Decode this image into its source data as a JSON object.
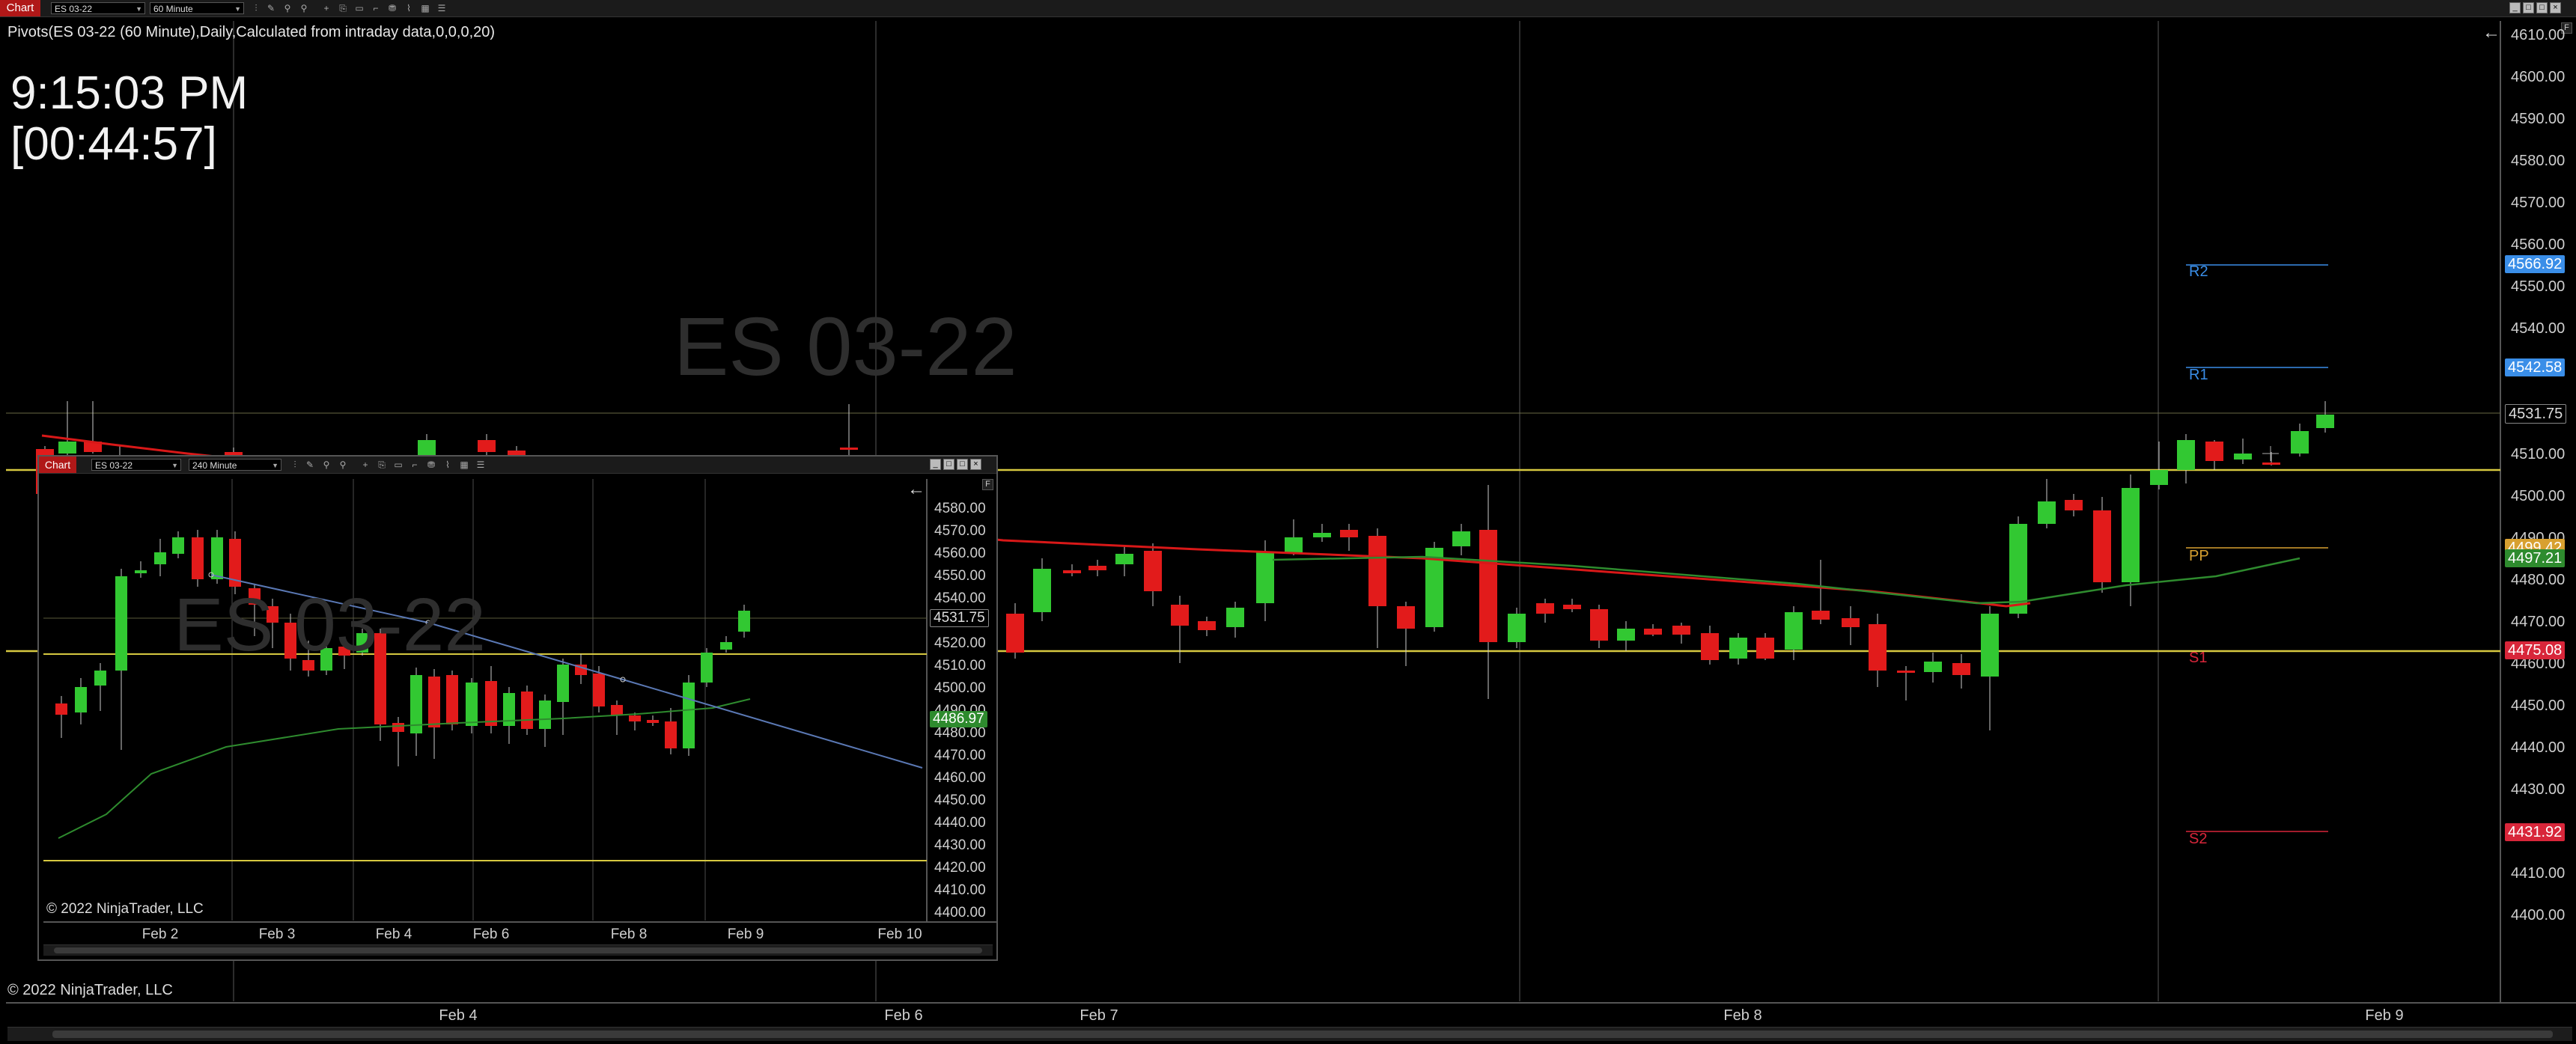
{
  "main": {
    "toolbar": {
      "tab_label": "Chart",
      "instrument": "ES 03-22",
      "interval": "60 Minute",
      "window_buttons": [
        "_",
        "□",
        "□",
        "×"
      ],
      "f_button": "F"
    },
    "indicator_label": "Pivots(ES 03-22 (60 Minute),Daily,Calculated from intraday data,0,0,0,20)",
    "clock_time": "9:15:03 PM",
    "clock_countdown": "[00:44:57]",
    "watermark": "ES 03-22",
    "copyright": "© 2022 NinjaTrader, LLC",
    "y_axis": [
      "4610.00",
      "4600.00",
      "4590.00",
      "4580.00",
      "4570.00",
      "4560.00",
      "4550.00",
      "4540.00",
      "4530.00",
      "4520.00",
      "4510.00",
      "4500.00",
      "4490.00",
      "4480.00",
      "4470.00",
      "4460.00",
      "4450.00",
      "4440.00",
      "4430.00",
      "4420.00",
      "4410.00",
      "4400.00"
    ],
    "x_axis": [
      "Feb 4",
      "Feb 6",
      "Feb 7",
      "Feb 8",
      "Feb 9"
    ],
    "price_tags": {
      "r2": "4566.92",
      "r1": "4542.58",
      "last": "4531.75",
      "pp": "4499.42",
      "sma": "4497.21",
      "s1": "4475.08",
      "s2": "4431.92"
    },
    "pivot_labels": {
      "r2": "R2",
      "r1": "R1",
      "pp": "PP",
      "s1": "S1",
      "s2": "S2"
    },
    "colors": {
      "up": "#32c832",
      "down": "#e21b1b",
      "ma": "#d81818",
      "sma_green": "#2e8b2e",
      "pivot_yellow": "#d6c840",
      "r_color": "#3a8ee8",
      "s_color": "#d8263a",
      "pp_color": "#d8a030"
    }
  },
  "inset": {
    "toolbar": {
      "tab_label": "Chart",
      "instrument": "ES 03-22",
      "interval": "240 Minute",
      "f_button": "F"
    },
    "watermark": "ES 03-22",
    "copyright": "© 2022 NinjaTrader, LLC",
    "y_axis": [
      "4580.00",
      "4570.00",
      "4560.00",
      "4550.00",
      "4540.00",
      "4530.00",
      "4520.00",
      "4510.00",
      "4500.00",
      "4490.00",
      "4480.00",
      "4470.00",
      "4460.00",
      "4450.00",
      "4440.00",
      "4430.00",
      "4420.00",
      "4410.00",
      "4400.00"
    ],
    "x_axis": [
      "Feb 2",
      "Feb 3",
      "Feb 4",
      "Feb 6",
      "Feb 8",
      "Feb 9",
      "Feb 10"
    ],
    "price_tags": {
      "last": "4531.75",
      "sma": "4486.97"
    }
  }
}
